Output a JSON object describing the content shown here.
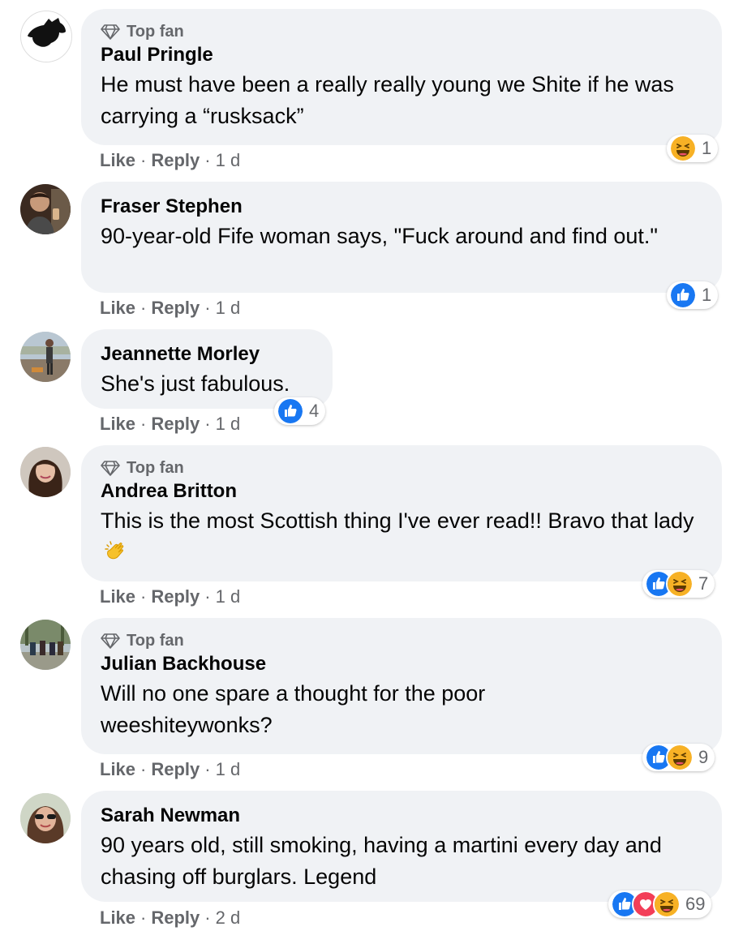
{
  "comments": [
    {
      "top_fan_label": "Top fan",
      "author": "Paul Pringle",
      "text": "He must have been a really really young we Shite if he was carrying a “rusksack”",
      "like_label": "Like",
      "reply_label": "Reply",
      "separator": "·",
      "time": "1 d",
      "reaction_count": "1",
      "reactions": [
        "haha-icon"
      ]
    },
    {
      "author": "Fraser Stephen",
      "text": "90-year-old Fife woman says, \"Fuck around and find out.\"",
      "like_label": "Like",
      "reply_label": "Reply",
      "separator": "·",
      "time": "1 d",
      "reaction_count": "1",
      "reactions": [
        "like-icon"
      ]
    },
    {
      "author": "Jeannette Morley",
      "text": "She's just fabulous.",
      "like_label": "Like",
      "reply_label": "Reply",
      "separator": "·",
      "time": "1 d",
      "reaction_count": "4",
      "reactions": [
        "like-icon"
      ]
    },
    {
      "top_fan_label": "Top fan",
      "author": "Andrea Britton",
      "text": "This is the most Scottish thing I've ever read!! Bravo that lady",
      "inline_emoji": "clapping-hands-emoji",
      "like_label": "Like",
      "reply_label": "Reply",
      "separator": "·",
      "time": "1 d",
      "reaction_count": "7",
      "reactions": [
        "like-icon",
        "haha-icon"
      ]
    },
    {
      "top_fan_label": "Top fan",
      "author": "Julian Backhouse",
      "text": "Will no one spare a thought for the poor weeshiteywonks?",
      "like_label": "Like",
      "reply_label": "Reply",
      "separator": "·",
      "time": "1 d",
      "reaction_count": "9",
      "reactions": [
        "like-icon",
        "haha-icon"
      ]
    },
    {
      "author": "Sarah Newman",
      "text": "90 years old, still smoking, having a martini every day and chasing off burglars. Legend",
      "like_label": "Like",
      "reply_label": "Reply",
      "separator": "·",
      "time": "2 d",
      "reaction_count": "69",
      "reactions": [
        "like-icon",
        "love-icon",
        "haha-icon"
      ]
    }
  ],
  "colors": {
    "bubble": "#f0f2f5",
    "meta_text": "#65676b",
    "like_blue": "#1877f2",
    "love_red": "#f33e58",
    "haha_yellow": "#f7b125"
  }
}
